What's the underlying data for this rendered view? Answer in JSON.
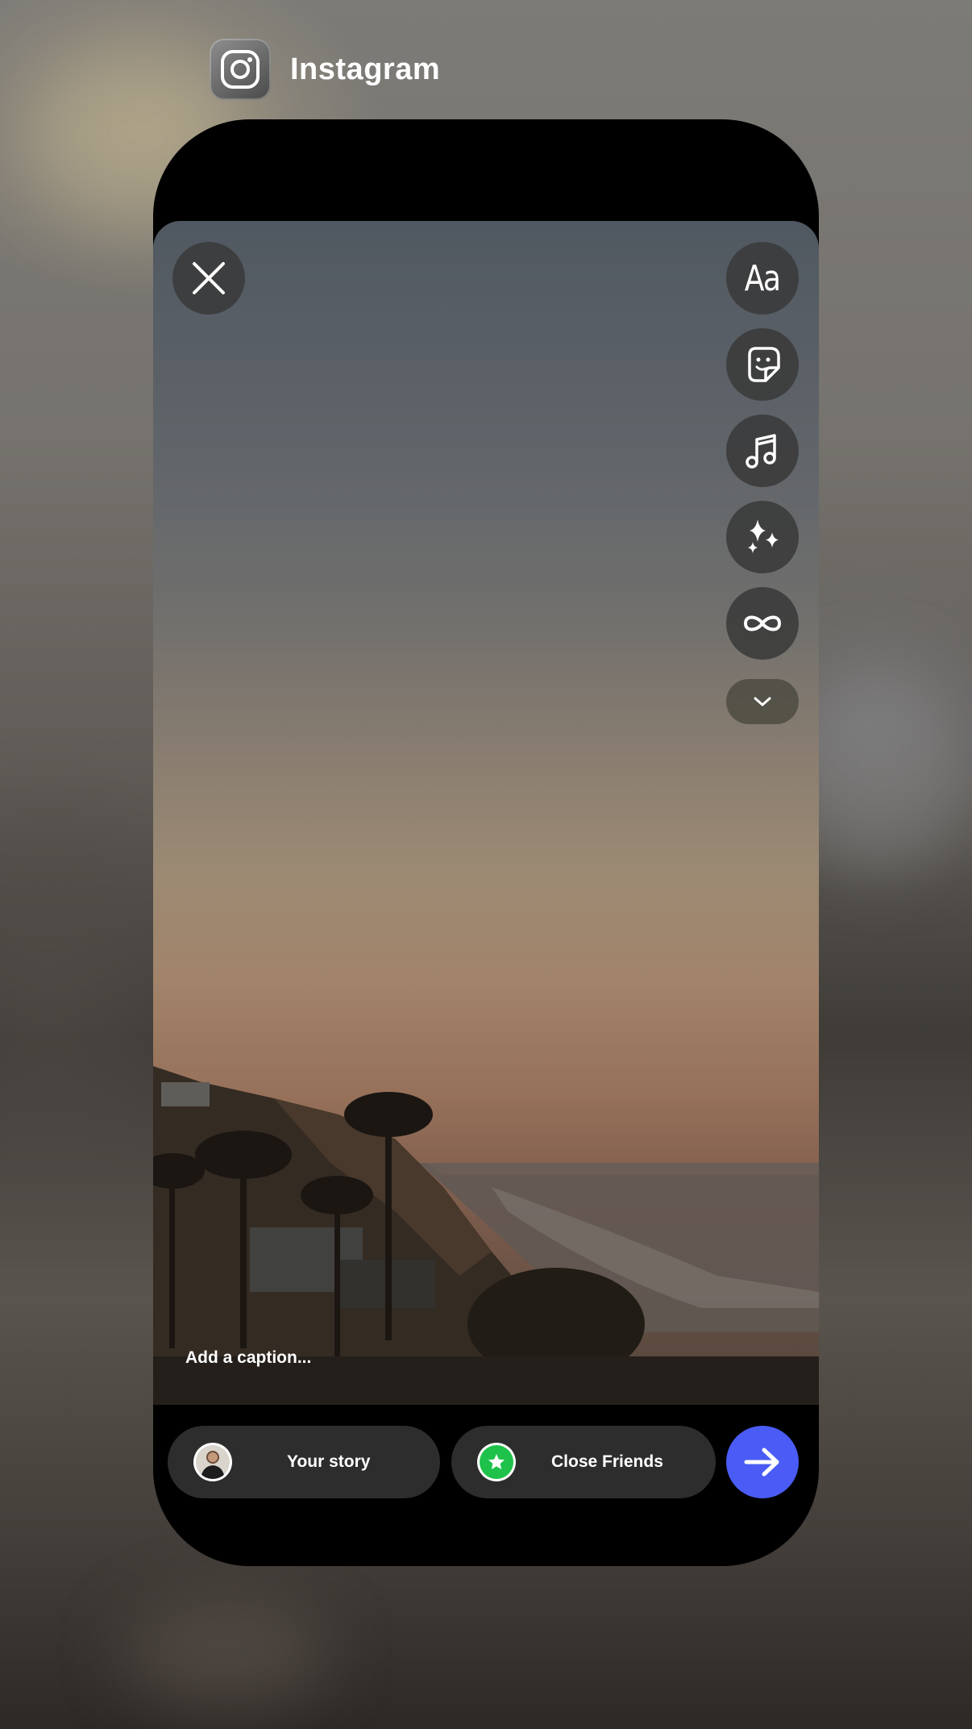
{
  "app_switcher": {
    "app_name": "Instagram",
    "app_icon": "instagram-camera-icon"
  },
  "story_editor": {
    "close_icon": "close-icon",
    "tools": [
      {
        "name": "text",
        "label": "Aa",
        "icon": "text-tool-icon"
      },
      {
        "name": "sticker",
        "icon": "sticker-icon"
      },
      {
        "name": "music",
        "icon": "music-note-icon"
      },
      {
        "name": "effects",
        "icon": "sparkles-icon"
      },
      {
        "name": "boomerang",
        "icon": "infinity-icon"
      },
      {
        "name": "more",
        "icon": "chevron-down-icon"
      }
    ],
    "caption_placeholder": "Add a caption..."
  },
  "share_bar": {
    "your_story_label": "Your story",
    "close_friends_label": "Close Friends",
    "send_icon": "arrow-right-icon"
  },
  "colors": {
    "send_button": "#4a5cf5",
    "close_friends_badge": "#1ec24a",
    "pill_background": "#2d2d2d"
  }
}
